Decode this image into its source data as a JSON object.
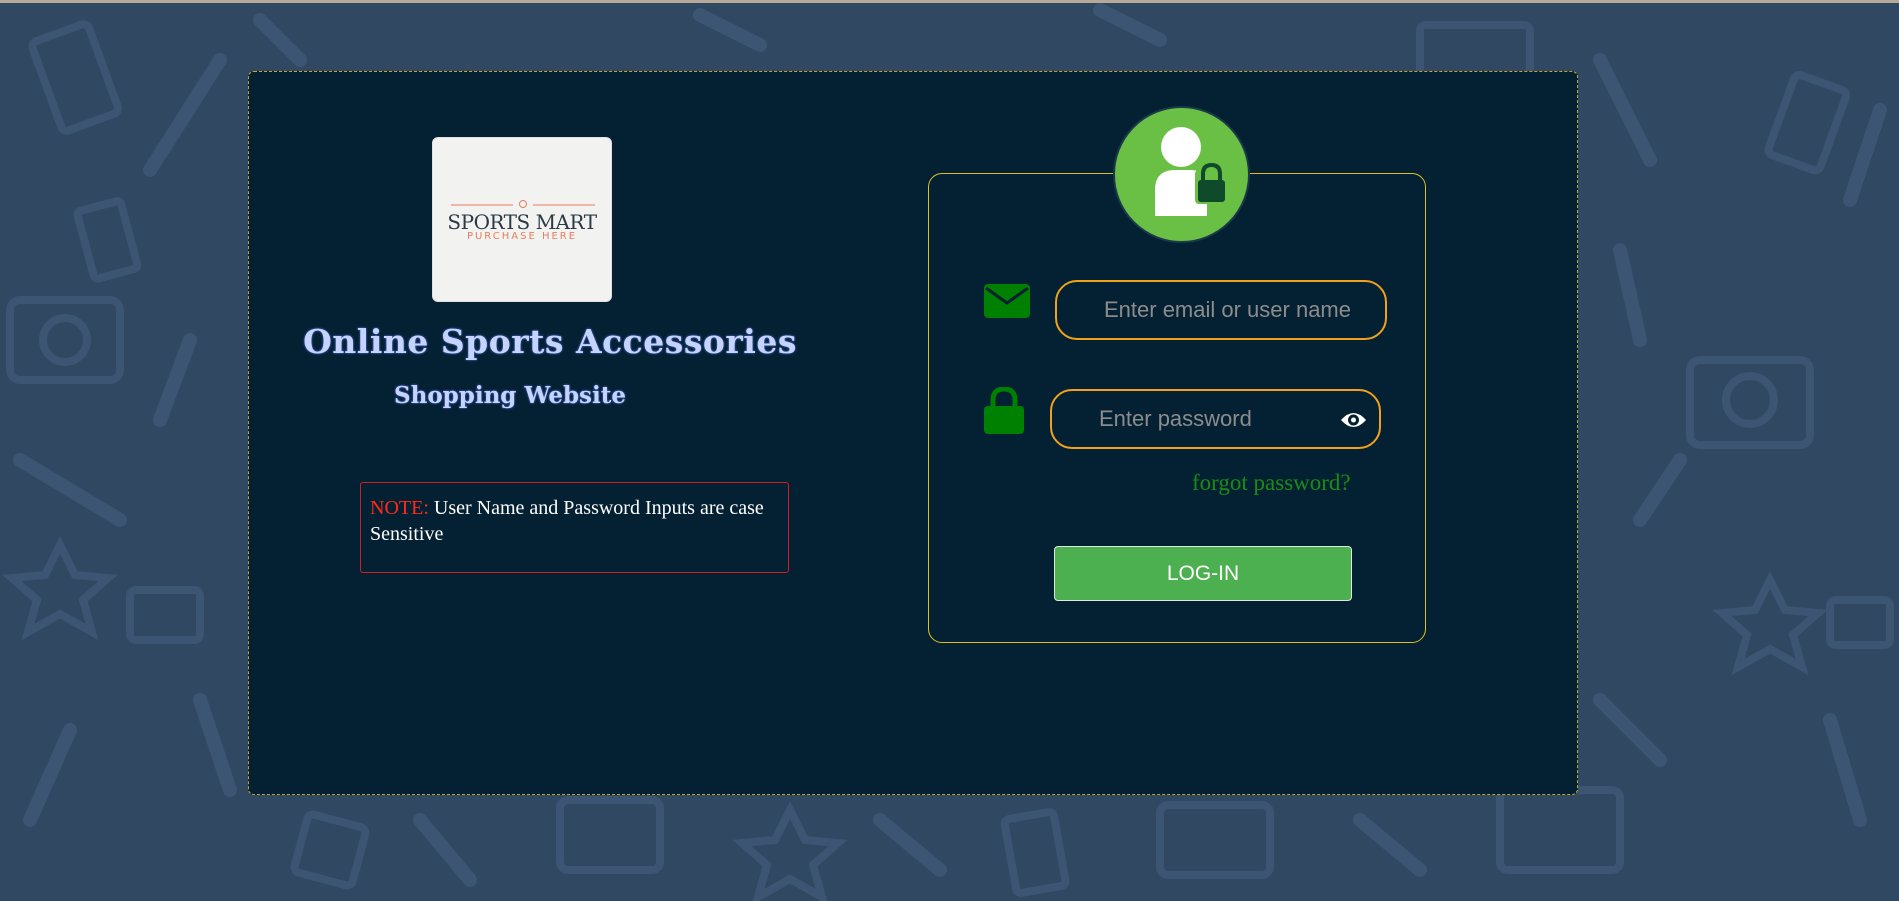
{
  "brand": {
    "logo_title": "SPORTS MART",
    "logo_subtitle": "PURCHASE HERE",
    "site_title": "Online Sports Accessories",
    "site_subtitle": "Shopping Website"
  },
  "note": {
    "label": "NOTE:",
    "text": " User Name and Password Inputs are case Sensitive"
  },
  "login": {
    "email_placeholder": "Enter email or user name",
    "email_value": "",
    "password_placeholder": "Enter password",
    "password_value": "",
    "forgot_label": "forgot password?",
    "button_label": "LOG-IN"
  },
  "icons": {
    "avatar": "user-lock-icon",
    "email": "envelope-icon",
    "password": "lock-icon",
    "toggle": "eye-icon"
  },
  "colors": {
    "page_bg": "#314863",
    "panel_bg": "#042133",
    "accent_green": "#4caf50",
    "icon_green": "#008000",
    "note_red": "#ff2a1a",
    "field_border": "#f0a21a"
  }
}
